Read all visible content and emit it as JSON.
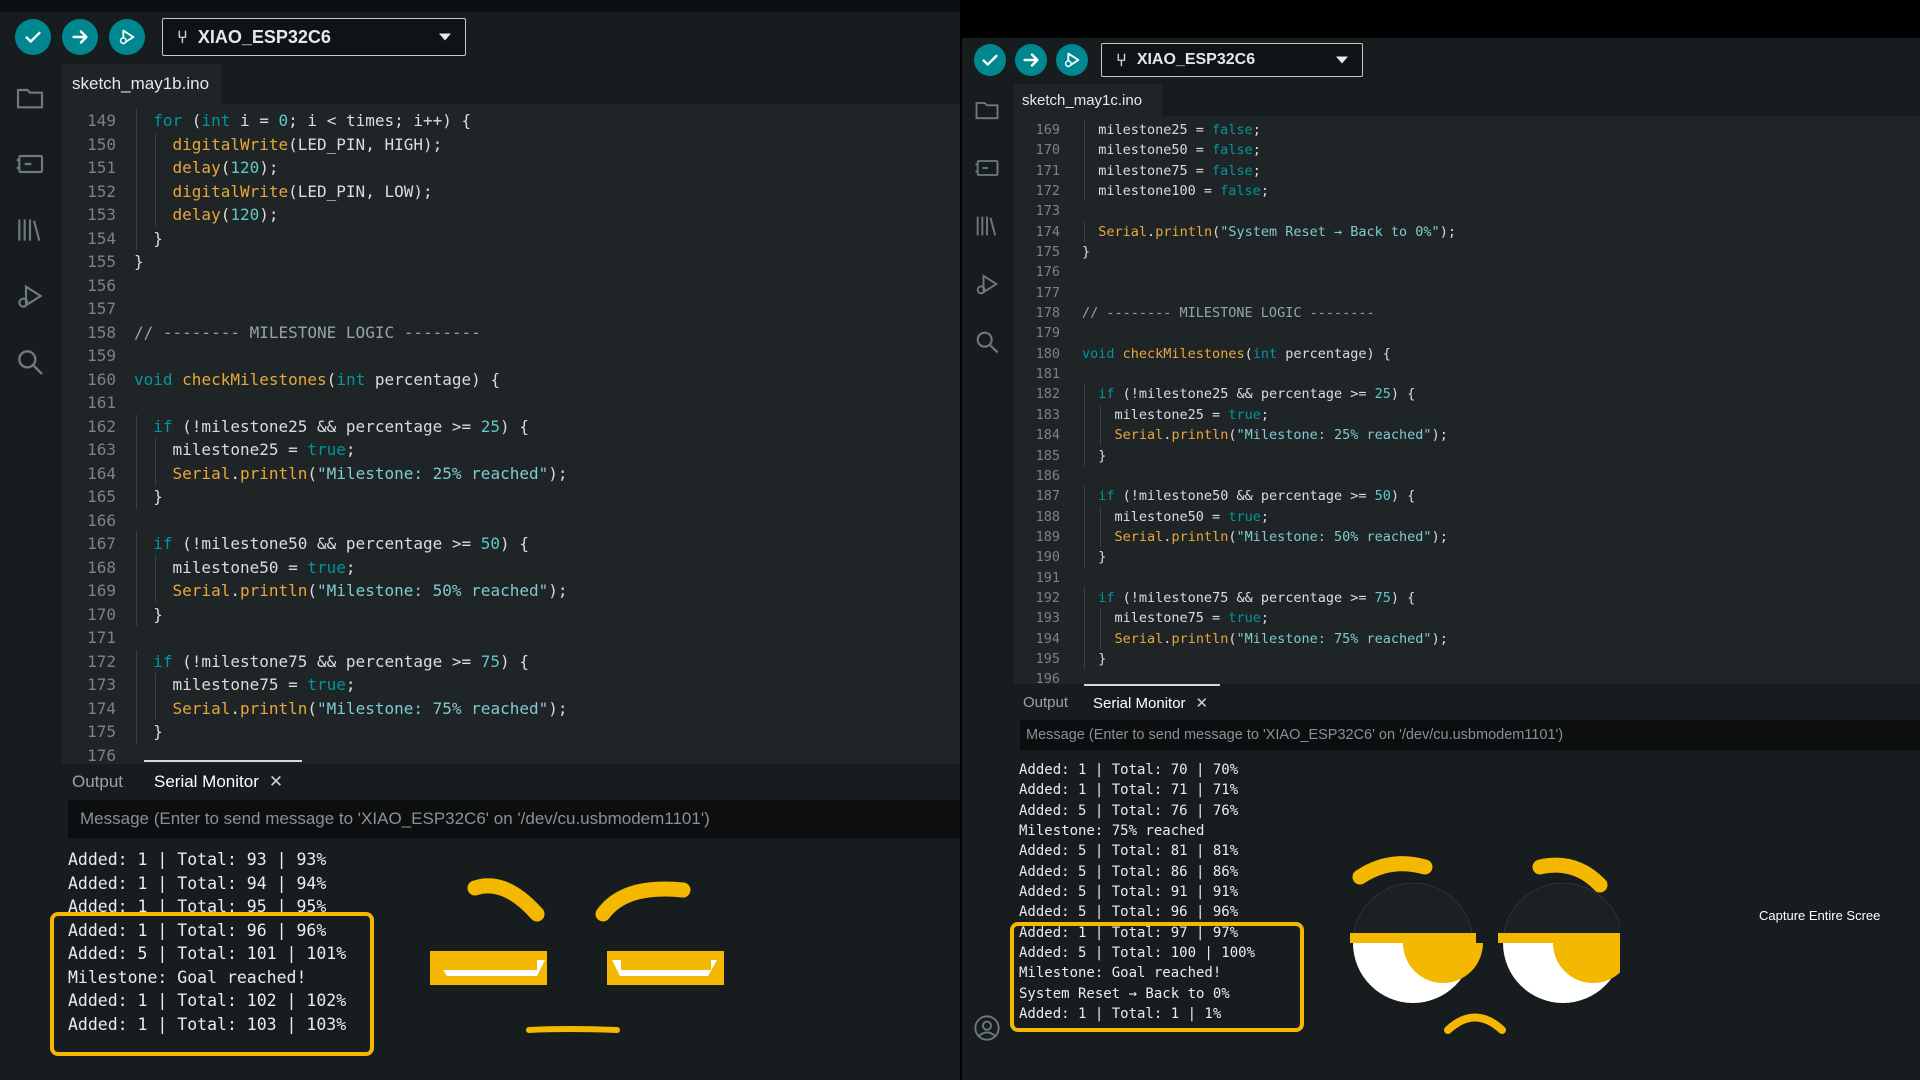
{
  "left": {
    "board": "XIAO_ESP32C6",
    "file_tab": "sketch_may1b.ino",
    "code": [
      {
        "n": "149",
        "t": "  for (int i = 0; i < times; i++) {"
      },
      {
        "n": "150",
        "t": "    digitalWrite(LED_PIN, HIGH);"
      },
      {
        "n": "151",
        "t": "    delay(120);"
      },
      {
        "n": "152",
        "t": "    digitalWrite(LED_PIN, LOW);"
      },
      {
        "n": "153",
        "t": "    delay(120);"
      },
      {
        "n": "154",
        "t": "  }"
      },
      {
        "n": "155",
        "t": "}"
      },
      {
        "n": "156",
        "t": ""
      },
      {
        "n": "157",
        "t": ""
      },
      {
        "n": "158",
        "t": "// -------- MILESTONE LOGIC --------"
      },
      {
        "n": "159",
        "t": ""
      },
      {
        "n": "160",
        "t": "void checkMilestones(int percentage) {"
      },
      {
        "n": "161",
        "t": ""
      },
      {
        "n": "162",
        "t": "  if (!milestone25 && percentage >= 25) {"
      },
      {
        "n": "163",
        "t": "    milestone25 = true;"
      },
      {
        "n": "164",
        "t": "    Serial.println(\"Milestone: 25% reached\");"
      },
      {
        "n": "165",
        "t": "  }"
      },
      {
        "n": "166",
        "t": ""
      },
      {
        "n": "167",
        "t": "  if (!milestone50 && percentage >= 50) {"
      },
      {
        "n": "168",
        "t": "    milestone50 = true;"
      },
      {
        "n": "169",
        "t": "    Serial.println(\"Milestone: 50% reached\");"
      },
      {
        "n": "170",
        "t": "  }"
      },
      {
        "n": "171",
        "t": ""
      },
      {
        "n": "172",
        "t": "  if (!milestone75 && percentage >= 75) {"
      },
      {
        "n": "173",
        "t": "    milestone75 = true;"
      },
      {
        "n": "174",
        "t": "    Serial.println(\"Milestone: 75% reached\");"
      },
      {
        "n": "175",
        "t": "  }"
      },
      {
        "n": "176",
        "t": ""
      }
    ],
    "panel_tabs": {
      "output": "Output",
      "serial": "Serial Monitor"
    },
    "message_placeholder": "Message (Enter to send message to 'XIAO_ESP32C6' on '/dev/cu.usbmodem1101')",
    "serial": [
      "Added: 1 | Total: 93 | 93%",
      "Added: 1 | Total: 94 | 94%",
      "Added: 1 | Total: 95 | 95%",
      "Added: 1 | Total: 96 | 96%",
      "Added: 5 | Total: 101 | 101%",
      "Milestone: Goal reached!",
      "Added: 1 | Total: 102 | 102%",
      "Added: 1 | Total: 103 | 103%"
    ]
  },
  "right": {
    "board": "XIAO_ESP32C6",
    "file_tab": "sketch_may1c.ino",
    "code": [
      {
        "n": "169",
        "t": "  milestone25 = false;"
      },
      {
        "n": "170",
        "t": "  milestone50 = false;"
      },
      {
        "n": "171",
        "t": "  milestone75 = false;"
      },
      {
        "n": "172",
        "t": "  milestone100 = false;"
      },
      {
        "n": "173",
        "t": ""
      },
      {
        "n": "174",
        "t": "  Serial.println(\"System Reset → Back to 0%\");"
      },
      {
        "n": "175",
        "t": "}"
      },
      {
        "n": "176",
        "t": ""
      },
      {
        "n": "177",
        "t": ""
      },
      {
        "n": "178",
        "t": "// -------- MILESTONE LOGIC --------"
      },
      {
        "n": "179",
        "t": ""
      },
      {
        "n": "180",
        "t": "void checkMilestones(int percentage) {"
      },
      {
        "n": "181",
        "t": ""
      },
      {
        "n": "182",
        "t": "  if (!milestone25 && percentage >= 25) {"
      },
      {
        "n": "183",
        "t": "    milestone25 = true;"
      },
      {
        "n": "184",
        "t": "    Serial.println(\"Milestone: 25% reached\");"
      },
      {
        "n": "185",
        "t": "  }"
      },
      {
        "n": "186",
        "t": ""
      },
      {
        "n": "187",
        "t": "  if (!milestone50 && percentage >= 50) {"
      },
      {
        "n": "188",
        "t": "    milestone50 = true;"
      },
      {
        "n": "189",
        "t": "    Serial.println(\"Milestone: 50% reached\");"
      },
      {
        "n": "190",
        "t": "  }"
      },
      {
        "n": "191",
        "t": ""
      },
      {
        "n": "192",
        "t": "  if (!milestone75 && percentage >= 75) {"
      },
      {
        "n": "193",
        "t": "    milestone75 = true;"
      },
      {
        "n": "194",
        "t": "    Serial.println(\"Milestone: 75% reached\");"
      },
      {
        "n": "195",
        "t": "  }"
      },
      {
        "n": "196",
        "t": ""
      }
    ],
    "panel_tabs": {
      "output": "Output",
      "serial": "Serial Monitor"
    },
    "message_placeholder": "Message (Enter to send message to 'XIAO_ESP32C6' on '/dev/cu.usbmodem1101')",
    "serial": [
      "Added: 1 | Total: 70 | 70%",
      "Added: 1 | Total: 71 | 71%",
      "Added: 5 | Total: 76 | 76%",
      "Milestone: 75% reached",
      "Added: 5 | Total: 81 | 81%",
      "Added: 5 | Total: 86 | 86%",
      "Added: 5 | Total: 91 | 91%",
      "Added: 5 | Total: 96 | 96%",
      "Added: 1 | Total: 97 | 97%",
      "Added: 5 | Total: 100 | 100%",
      "Milestone: Goal reached!",
      "System Reset → Back to 0%",
      "Added: 1 | Total: 1 | 1%"
    ],
    "capture_label": "Capture Entire Scree"
  },
  "colors": {
    "accent": "#00878f",
    "highlight": "#f5b800",
    "keyword": "#00979d",
    "function": "#e8a73a",
    "string": "#7fcbcd"
  },
  "icons": [
    "verify-icon",
    "upload-icon",
    "debug-icon",
    "usb-icon",
    "folder-icon",
    "board-manager-icon",
    "library-icon",
    "debug-sidebar-icon",
    "search-icon",
    "profile-icon"
  ]
}
